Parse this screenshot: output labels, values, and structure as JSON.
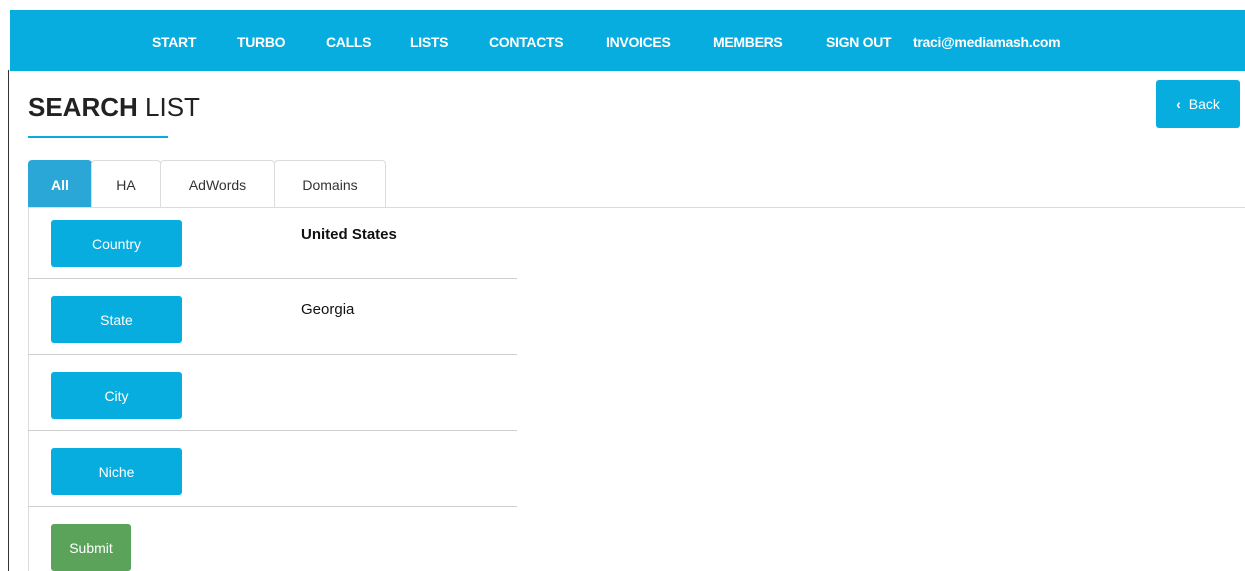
{
  "nav": {
    "items": [
      "START",
      "TURBO",
      "CALLS",
      "LISTS",
      "CONTACTS",
      "INVOICES",
      "MEMBERS",
      "SIGN OUT"
    ],
    "user_email": "traci@mediamash.com"
  },
  "header": {
    "title_bold": "SEARCH",
    "title_light": " LIST",
    "back_label": "Back"
  },
  "tabs": [
    {
      "label": "All",
      "active": true
    },
    {
      "label": "HA",
      "active": false
    },
    {
      "label": "AdWords",
      "active": false
    },
    {
      "label": "Domains",
      "active": false
    }
  ],
  "fields": [
    {
      "label": "Country",
      "value": "United States"
    },
    {
      "label": "State",
      "value": "Georgia"
    },
    {
      "label": "City",
      "value": ""
    },
    {
      "label": "Niche",
      "value": ""
    }
  ],
  "submit_label": "Submit",
  "colors": {
    "nav_bg": "#08addf",
    "button_blue": "#08addf",
    "tab_active": "#2aa7d6",
    "submit_green": "#5ba35b"
  }
}
